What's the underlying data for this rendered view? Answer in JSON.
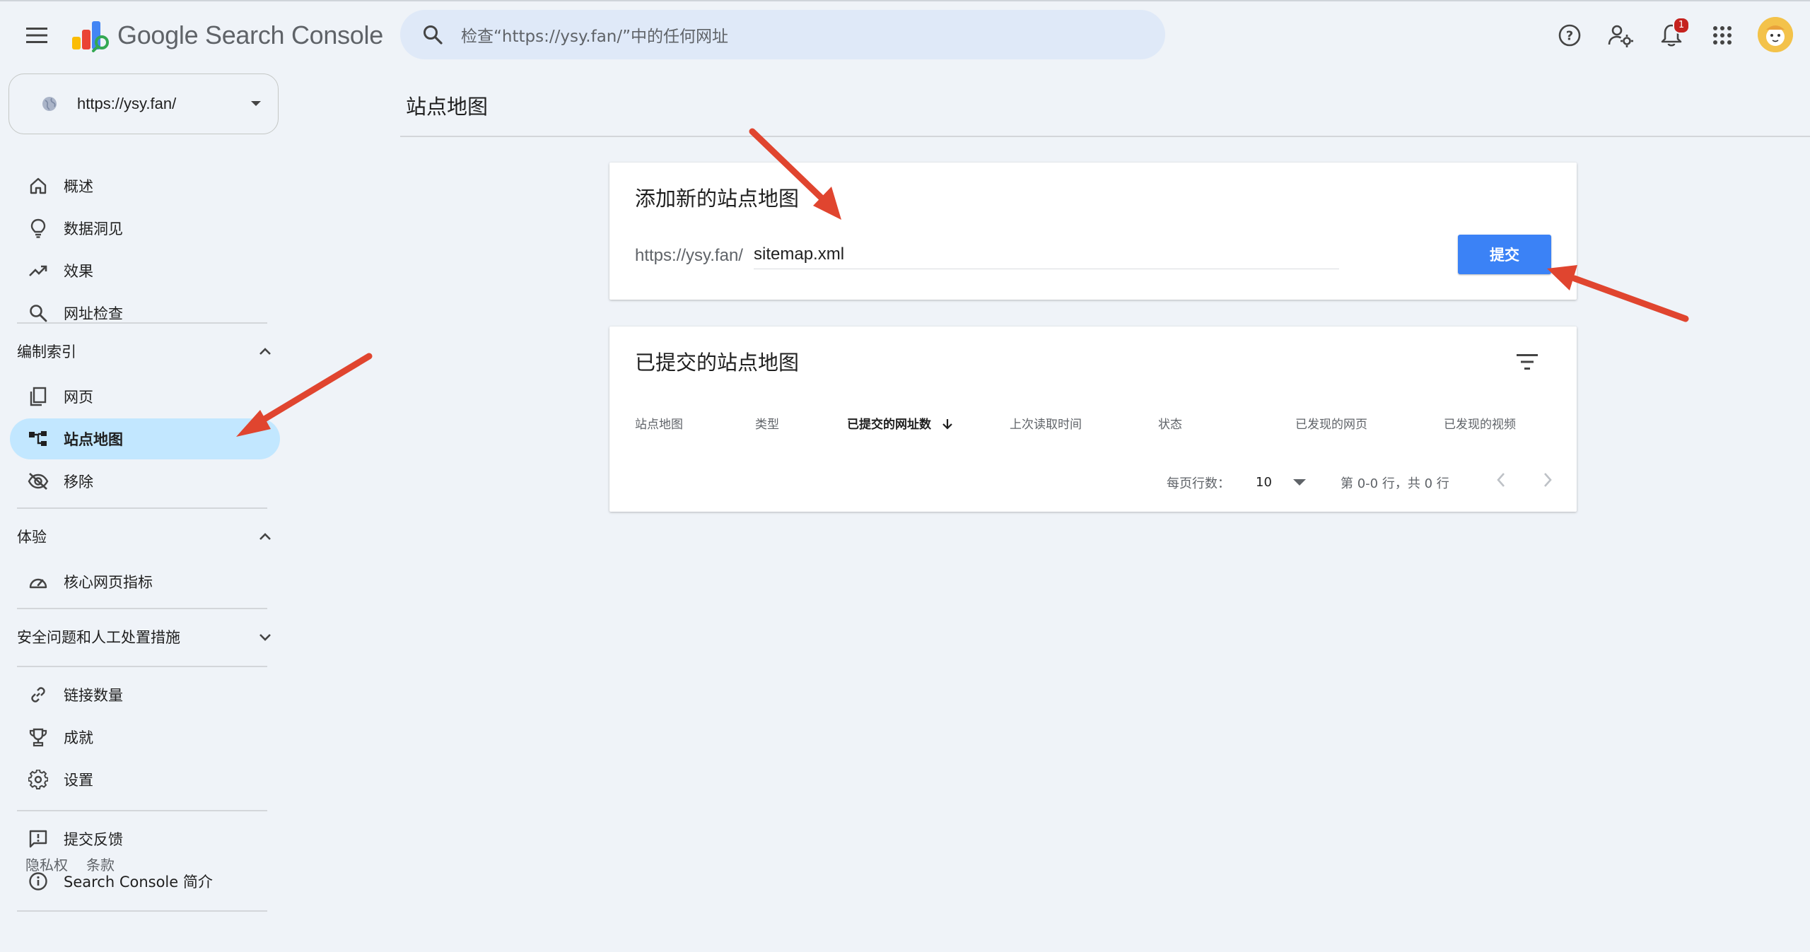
{
  "header": {
    "app_name": "Google Search Console",
    "search_placeholder": "检查“https://ysy.fan/”中的任何网址",
    "notification_count": "1",
    "icons": [
      "menu-icon",
      "help-icon",
      "manage-users-icon",
      "notifications-icon",
      "apps-icon",
      "avatar"
    ]
  },
  "sidebar": {
    "property_url": "https://ysy.fan/",
    "nav": [
      {
        "label": "概述",
        "icon": "home-icon"
      },
      {
        "label": "数据洞见",
        "icon": "lightbulb-icon"
      },
      {
        "label": "效果",
        "icon": "trending-up-icon"
      },
      {
        "label": "网址检查",
        "icon": "search-icon"
      }
    ],
    "indexing": {
      "title": "编制索引",
      "items": [
        {
          "label": "网页",
          "icon": "pages-icon"
        },
        {
          "label": "站点地图",
          "icon": "sitemap-icon",
          "active": true
        },
        {
          "label": "移除",
          "icon": "visibility-off-icon"
        }
      ]
    },
    "experience": {
      "title": "体验",
      "items": [
        {
          "label": "核心网页指标",
          "icon": "speed-gauge-icon"
        }
      ]
    },
    "security": {
      "title": "安全问题和人工处置措施"
    },
    "more": [
      {
        "label": "链接数量",
        "icon": "link-icon"
      },
      {
        "label": "成就",
        "icon": "trophy-icon"
      },
      {
        "label": "设置",
        "icon": "gear-icon"
      }
    ],
    "support": [
      {
        "label": "提交反馈",
        "icon": "feedback-icon"
      },
      {
        "label": "Search Console 简介",
        "icon": "info-icon"
      }
    ],
    "footer": {
      "privacy": "隐私权",
      "terms": "条款"
    }
  },
  "main": {
    "page_title": "站点地图",
    "add_card": {
      "title": "添加新的站点地图",
      "url_prefix": "https://ysy.fan/",
      "input_value": "sitemap.xml",
      "submit_label": "提交"
    },
    "submitted_card": {
      "title": "已提交的站点地图",
      "columns": [
        "站点地图",
        "类型",
        "已提交的网址数",
        "上次读取时间",
        "状态",
        "已发现的网页",
        "已发现的视频"
      ],
      "sorted_column": "已提交的网址数",
      "rows_per_page_label": "每页行数：",
      "rows_per_page": "10",
      "range_text": "第 0-0 行，共 0 行"
    }
  },
  "colors": {
    "background": "#eff3f8",
    "accent_blue": "#3b82f6",
    "active_nav": "#c2e7ff",
    "annotation_arrow": "#e0452f"
  }
}
